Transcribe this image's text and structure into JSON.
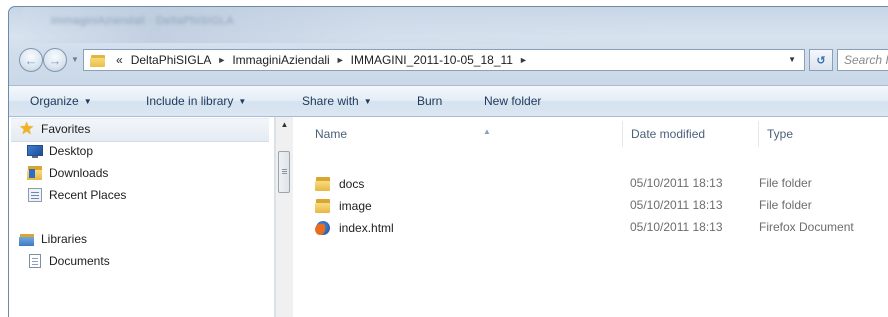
{
  "window": {
    "title": "ImmaginiAziendali · DeltaPhiSIGLA"
  },
  "address_bar": {
    "crumbs": [
      "DeltaPhiSIGLA",
      "ImmaginiAziendali",
      "IMMAGINI_2011-10-05_18_11"
    ],
    "overflow": "«",
    "search_placeholder": "Search IM"
  },
  "toolbar": {
    "organize": "Organize",
    "include_in_library": "Include in library",
    "share_with": "Share with",
    "burn": "Burn",
    "new_folder": "New folder"
  },
  "nav": {
    "favorites": "Favorites",
    "desktop": "Desktop",
    "downloads": "Downloads",
    "recent_places": "Recent Places",
    "libraries": "Libraries",
    "documents": "Documents"
  },
  "columns": {
    "name": "Name",
    "date_modified": "Date modified",
    "type": "Type"
  },
  "files": [
    {
      "name": "docs",
      "date": "05/10/2011 18:13",
      "type": "File folder",
      "icon": "folder-icon"
    },
    {
      "name": "image",
      "date": "05/10/2011 18:13",
      "type": "File folder",
      "icon": "folder-icon"
    },
    {
      "name": "index.html",
      "date": "05/10/2011 18:13",
      "type": "Firefox Document",
      "icon": "firefox-document-icon"
    }
  ],
  "colors": {
    "frame": "#c9d8e8",
    "command_text": "#1e395b",
    "column_header_text": "#4c607a",
    "secondary_text": "#6d6d6d"
  }
}
